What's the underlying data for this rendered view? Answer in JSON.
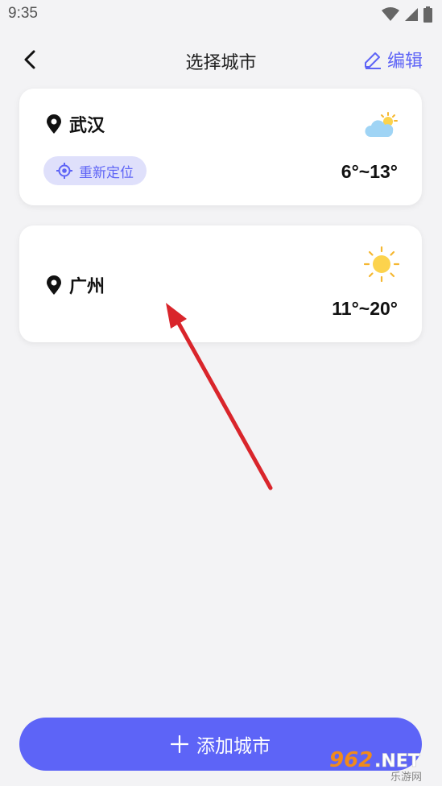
{
  "status_bar": {
    "time": "9:35",
    "icons": [
      "wifi-icon",
      "signal-icon",
      "battery-icon"
    ]
  },
  "nav": {
    "back_icon": "chevron-left-icon",
    "title": "选择城市",
    "edit_label": "编辑",
    "edit_icon": "pencil-icon"
  },
  "cities": [
    {
      "name": "武汉",
      "weather_icon": "partly-cloudy-icon",
      "temp_range": "6°~13°",
      "relocate_label": "重新定位",
      "is_current_location": true
    },
    {
      "name": "广州",
      "weather_icon": "sunny-icon",
      "temp_range": "11°~20°",
      "is_current_location": false
    }
  ],
  "add_city": {
    "label": "添加城市",
    "icon": "plus-icon"
  },
  "watermark": {
    "brand": "962.NET",
    "subtitle": "乐游网"
  },
  "colors": {
    "accent": "#5d64f7",
    "relocate_bg": "#dfe0fb",
    "background": "#f3f3f5",
    "card": "#ffffff",
    "annotation_arrow": "#d9252b"
  }
}
